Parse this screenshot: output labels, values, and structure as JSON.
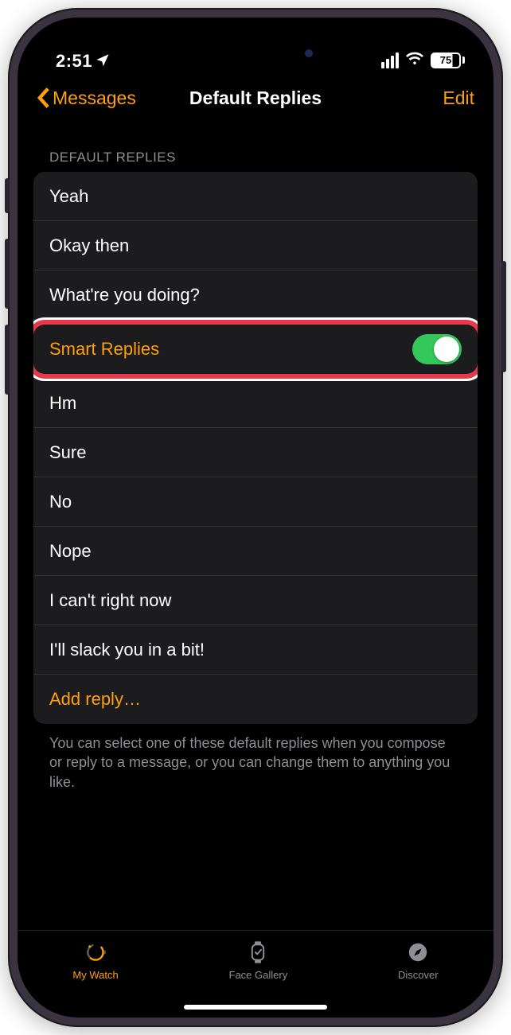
{
  "status": {
    "time": "2:51",
    "battery_pct": "75"
  },
  "nav": {
    "back_label": "Messages",
    "title": "Default Replies",
    "edit_label": "Edit"
  },
  "section": {
    "header": "DEFAULT REPLIES",
    "footer": "You can select one of these default replies when you compose or reply to a message, or you can change them to anything you like."
  },
  "rows": {
    "r0": "Yeah",
    "r1": "Okay then",
    "r2": "What're you doing?",
    "smart": "Smart Replies",
    "r3": "Hm",
    "r4": "Sure",
    "r5": "No",
    "r6": "Nope",
    "r7": "I can't right now",
    "r8": "I'll slack you in a bit!",
    "add": "Add reply…"
  },
  "smart_replies_on": true,
  "tabs": {
    "watch": "My Watch",
    "gallery": "Face Gallery",
    "discover": "Discover"
  }
}
